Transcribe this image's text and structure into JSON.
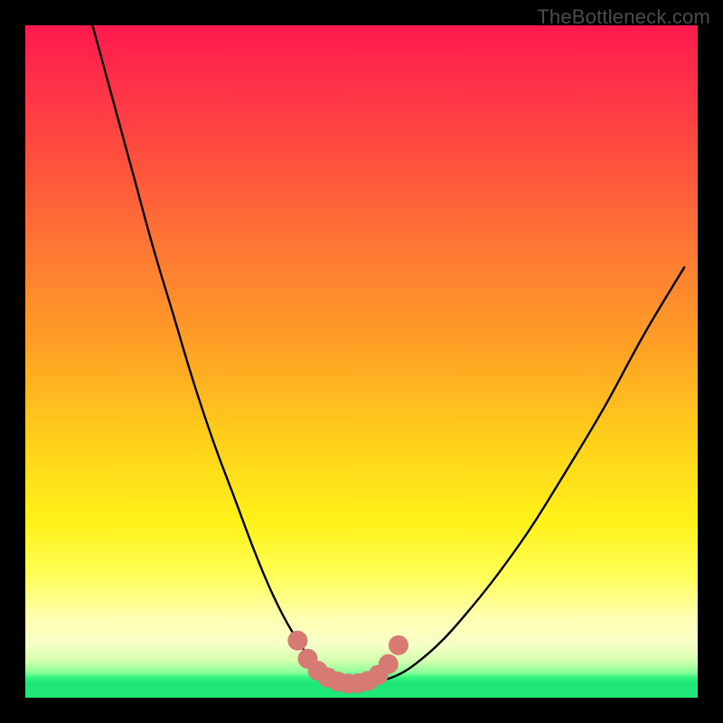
{
  "watermark": "TheBottleneck.com",
  "chart_data": {
    "type": "line",
    "title": "",
    "xlabel": "",
    "ylabel": "",
    "xlim": [
      0,
      100
    ],
    "ylim": [
      0,
      100
    ],
    "series": [
      {
        "name": "bottleneck-curve",
        "x": [
          10,
          13,
          16,
          19,
          22,
          25,
          28,
          31,
          34,
          36.5,
          39,
          41.5,
          43,
          44.5,
          46,
          48,
          50,
          52,
          55,
          58,
          62,
          66,
          70,
          75,
          80,
          86,
          92,
          98
        ],
        "y": [
          100,
          89,
          78,
          67,
          57,
          47,
          38,
          30,
          22,
          16,
          11,
          7,
          4.5,
          3,
          2.2,
          2,
          2,
          2.3,
          3.2,
          5,
          8.5,
          13,
          18,
          25,
          33,
          43,
          54,
          64
        ]
      }
    ],
    "markers": {
      "name": "highlight-points",
      "x": [
        40.5,
        42,
        43.5,
        45,
        46.5,
        48,
        49.5,
        51,
        52.5,
        54,
        55.5
      ],
      "y": [
        8.5,
        5.8,
        4.0,
        3.0,
        2.4,
        2.1,
        2.15,
        2.5,
        3.4,
        5.0,
        7.8
      ],
      "color": "#d87a74",
      "size": 11
    },
    "gradient_bands": [
      {
        "pos": 0.0,
        "color": "#ff1a4d"
      },
      {
        "pos": 0.35,
        "color": "#ff7a33"
      },
      {
        "pos": 0.66,
        "color": "#ffe01a"
      },
      {
        "pos": 0.9,
        "color": "#ffffc0"
      },
      {
        "pos": 0.97,
        "color": "#37f57e"
      },
      {
        "pos": 1.0,
        "color": "#20e878"
      }
    ]
  }
}
